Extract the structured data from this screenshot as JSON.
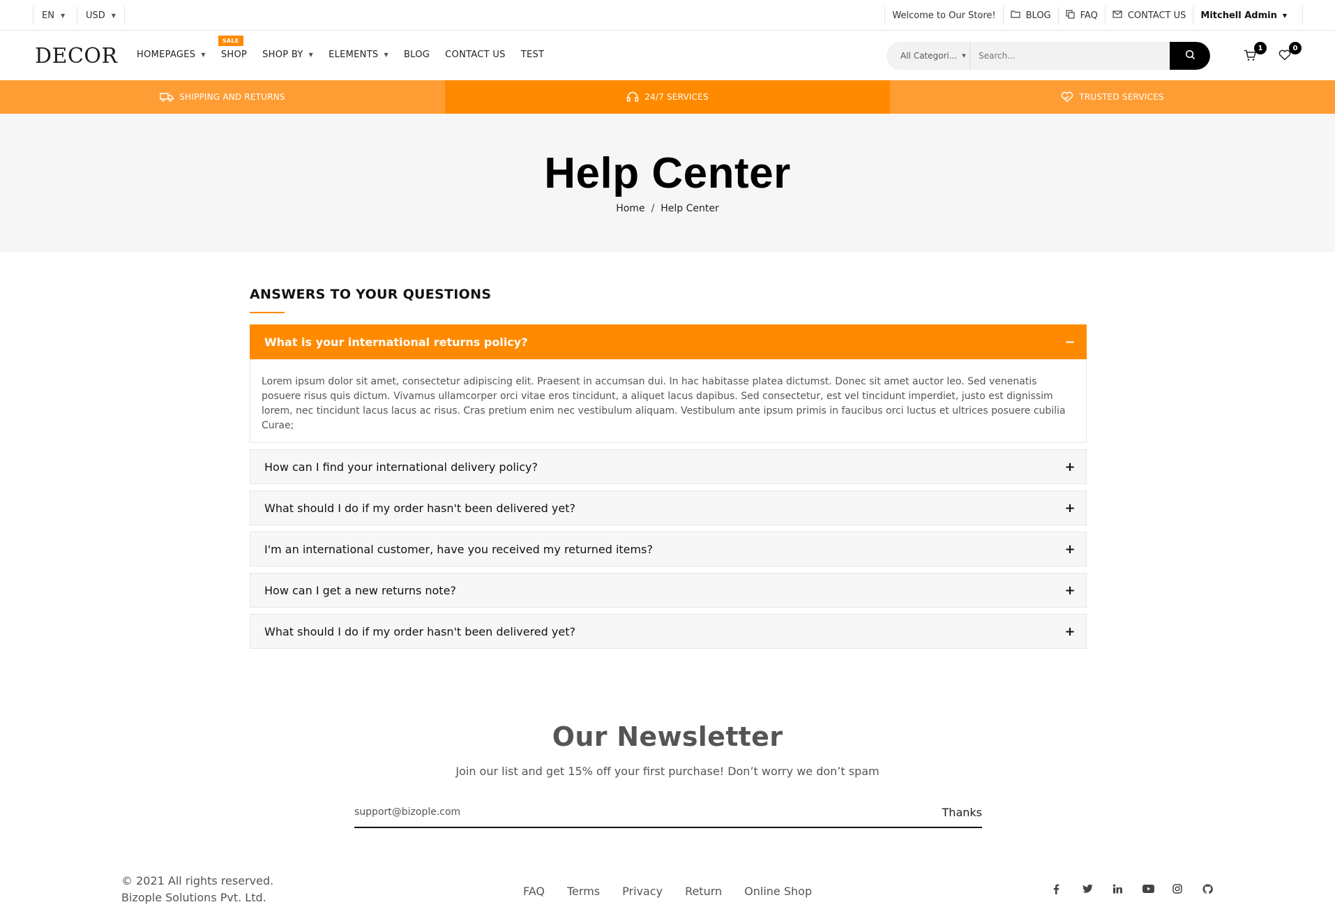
{
  "topbar": {
    "lang": "EN",
    "currency": "USD",
    "welcome": "Welcome to Our Store!",
    "blog": "BLOG",
    "faq": "FAQ",
    "contact": "CONTACT US",
    "user": "Mitchell Admin"
  },
  "header": {
    "logo": "DECOR",
    "nav": [
      {
        "label": "HOMEPAGES",
        "dropdown": true
      },
      {
        "label": "SHOP",
        "badge": "SALE"
      },
      {
        "label": "SHOP BY",
        "dropdown": true
      },
      {
        "label": "ELEMENTS",
        "dropdown": true
      },
      {
        "label": "BLOG"
      },
      {
        "label": "CONTACT US"
      },
      {
        "label": "TEST"
      }
    ],
    "search_category": "All Categori...",
    "search_placeholder": "Search...",
    "cart_count": "1",
    "wishlist_count": "0"
  },
  "services": [
    {
      "label": "SHIPPING AND RETURNS",
      "icon": "truck-icon"
    },
    {
      "label": "24/7 SERVICES",
      "icon": "headset-icon"
    },
    {
      "label": "TRUSTED SERVICES",
      "icon": "heart-handshake-icon"
    }
  ],
  "hero": {
    "title": "Help Center",
    "breadcrumb_home": "Home",
    "breadcrumb_sep": "/",
    "breadcrumb_current": "Help Center"
  },
  "faq": {
    "title": "ANSWERS TO YOUR QUESTIONS",
    "items": [
      {
        "question": "What is your international returns policy?",
        "open": true,
        "toggle": "−"
      },
      {
        "question": "How can I find your international delivery policy?",
        "toggle": "+"
      },
      {
        "question": "What should I do if my order hasn't been delivered yet?",
        "toggle": "+"
      },
      {
        "question": "I'm an international customer, have you received my returned items?",
        "toggle": "+"
      },
      {
        "question": "How can I get a new returns note?",
        "toggle": "+"
      },
      {
        "question": "What should I do if my order hasn't been delivered yet?",
        "toggle": "+"
      }
    ],
    "answer": "Lorem ipsum dolor sit amet, consectetur adipiscing elit. Praesent in accumsan dui. In hac habitasse platea dictumst. Donec sit amet auctor leo. Sed venenatis posuere risus quis dictum. Vivamus ullamcorper orci vitae eros tincidunt, a aliquet lacus dapibus. Sed consectetur, est vel tincidunt imperdiet, justo est dignissim lorem, nec tincidunt lacus lacus ac risus. Cras pretium enim nec vestibulum aliquam. Vestibulum ante ipsum primis in faucibus orci luctus et ultrices posuere cubilia Curae;"
  },
  "newsletter": {
    "title": "Our Newsletter",
    "subtitle": "Join our list and get 15% off your first purchase! Don’t worry we don’t spam",
    "email_value": "support@bizople.com",
    "button": "Thanks"
  },
  "footer": {
    "copyright": "© 2021 All rights reserved.",
    "company": "Bizople Solutions Pvt. Ltd.",
    "links": [
      "FAQ",
      "Terms",
      "Privacy",
      "Return",
      "Online Shop"
    ],
    "social": [
      "facebook-icon",
      "twitter-icon",
      "linkedin-icon",
      "youtube-icon",
      "instagram-icon",
      "github-icon"
    ]
  },
  "colors": {
    "accent": "#ff8a00",
    "accent_light": "#ff9d35",
    "hero_bg": "#f6f6f6"
  }
}
